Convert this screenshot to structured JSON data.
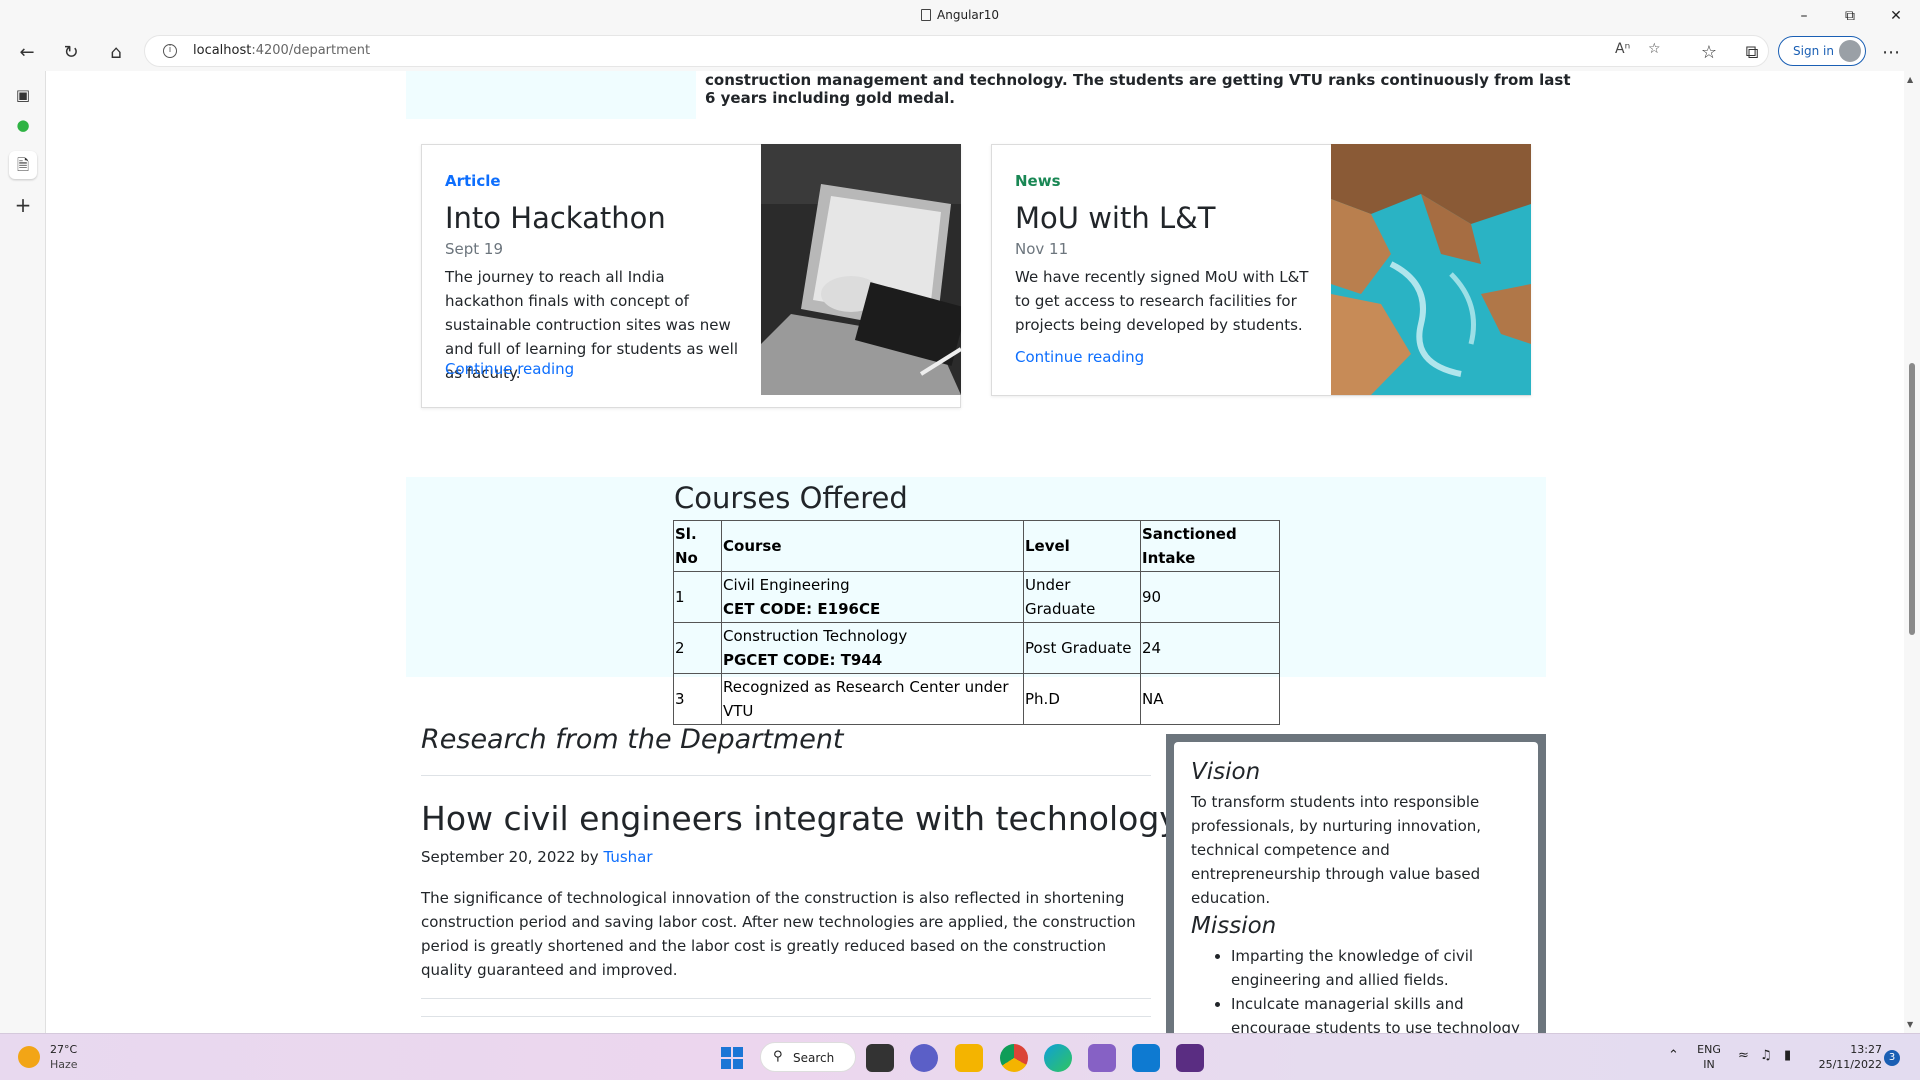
{
  "window": {
    "title": "Angular10"
  },
  "address_bar": {
    "host": "localhost",
    "path": ":4200/department"
  },
  "browser": {
    "signin_label": "Sign in"
  },
  "about": {
    "text": "construction management and technology. The students are getting VTU ranks continuously from last 6 years including gold medal."
  },
  "cards": [
    {
      "category": "Article",
      "category_color": "#0d6efd",
      "title": "Into Hackathon",
      "date": "Sept 19",
      "text": "The journey to reach all India hackathon finals with concept of sustainable contruction sites was new and full of learning for students as well as faculty.",
      "link": "Continue reading"
    },
    {
      "category": "News",
      "category_color": "#198754",
      "title": "MoU with L&T",
      "date": "Nov 11",
      "text": "We have recently signed MoU with L&T to get access to research facilities for projects being developed by students.",
      "link": "Continue reading"
    }
  ],
  "courses": {
    "title": "Courses Offered",
    "headers": [
      "Sl. No",
      "Course",
      "Level",
      "Sanctioned Intake"
    ],
    "rows": [
      {
        "sl": "1",
        "course": "Civil Engineering",
        "code": "CET CODE: E196CE",
        "level": "Under Graduate",
        "intake": "90"
      },
      {
        "sl": "2",
        "course": "Construction Technology",
        "code": "PGCET CODE: T944",
        "level": "Post Graduate",
        "intake": "24"
      },
      {
        "sl": "3",
        "course": "Recognized as Research Center under VTU",
        "code": "",
        "level": "Ph.D",
        "intake": "NA"
      }
    ]
  },
  "research": {
    "heading": "Research from the Department",
    "post_title": "How civil engineers integrate with technology",
    "post_date": "September 20, 2022 by",
    "post_author": "Tushar",
    "post_body": "The significance of technological innovation of the construction is also reflected in shortening construction period and saving labor cost. After new technologies are applied, the construction period is greatly shortened and the labor cost is greatly reduced based on the construction quality guaranteed and improved."
  },
  "vision_mission": {
    "vision_title": "Vision",
    "vision_text": "To transform students into responsible professionals, by nurturing innovation, technical competence and entrepreneurship through value based education.",
    "mission_title": "Mission",
    "mission_items": [
      "Imparting the knowledge of civil engineering and allied fields.",
      "Inculcate managerial skills and encourage students to use technology"
    ]
  },
  "taskbar": {
    "temperature": "27°C",
    "weather": "Haze",
    "search_label": "Search",
    "lang_top": "ENG",
    "lang_bottom": "IN",
    "time": "13:27",
    "date": "25/11/2022",
    "notification_count": "3"
  }
}
